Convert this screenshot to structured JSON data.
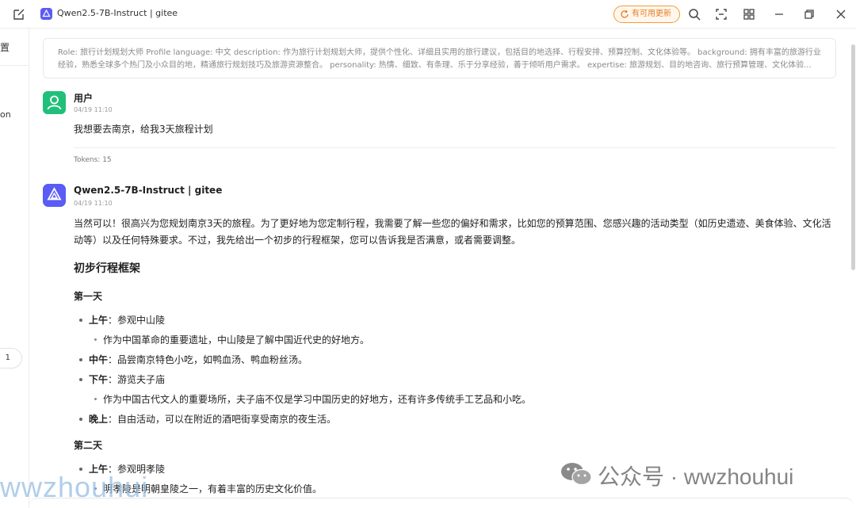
{
  "titlebar": {
    "title": "Qwen2.5-7B-Instruct | gitee",
    "update_label": "有可用更新",
    "accent": "#5b5bf5",
    "update_color": "#e67e22"
  },
  "sidebar": {
    "frag_1": "置",
    "frag_2": "on",
    "pill_count": "1"
  },
  "system_prompt": "Role: 旅行计划规划大师 Profile language: 中文 description: 作为旅行计划规划大师，提供个性化、详细且实用的旅行建议，包括目的地选择、行程安排、预算控制、文化体验等。 background: 拥有丰富的旅游行业经验，熟悉全球多个热门及小众目的地，精通旅行规划技巧及旅游资源整合。 personality: 热情、细致、有条理、乐于分享经验，善于倾听用户需求。 expertise: 旅游规划、目的地咨询、旅行预算管理、文化体验...",
  "user_message": {
    "name": "用户",
    "time": "04/19 11:10",
    "text": "我想要去南京，给我3天旅程计划",
    "tokens": "Tokens: 15"
  },
  "ai_message": {
    "name": "Qwen2.5-7B-Instruct | gitee",
    "time": "04/19 11:10",
    "intro": "当然可以！很高兴为您规划南京3天的旅程。为了更好地为您定制行程，我需要了解一些您的偏好和需求，比如您的预算范围、您感兴趣的活动类型（如历史遗迹、美食体验、文化活动等）以及任何特殊要求。不过，我先给出一个初步的行程框架，您可以告诉我是否满意，或者需要调整。",
    "section_title": "初步行程框架",
    "day1": {
      "title": "第一天",
      "morning_label": "上午",
      "morning_text": "：参观中山陵",
      "morning_sub": "作为中国革命的重要遗址，中山陵是了解中国近代史的好地方。",
      "noon_label": "中午",
      "noon_text": "：品尝南京特色小吃，如鸭血汤、鸭血粉丝汤。",
      "afternoon_label": "下午",
      "afternoon_text": "：游览夫子庙",
      "afternoon_sub": "作为中国古代文人的重要场所，夫子庙不仅是学习中国历史的好地方，还有许多传统手工艺品和小吃。",
      "evening_label": "晚上",
      "evening_text": "：自由活动，可以在附近的酒吧街享受南京的夜生活。"
    },
    "day2": {
      "title": "第二天",
      "morning_label": "上午",
      "morning_text": "：参观明孝陵",
      "morning_sub": "明孝陵是明朝皇陵之一，有着丰富的历史文化价值。"
    }
  },
  "watermarks": {
    "left": "wwzhouhui",
    "right": "公众号 · wwzhouhui"
  }
}
